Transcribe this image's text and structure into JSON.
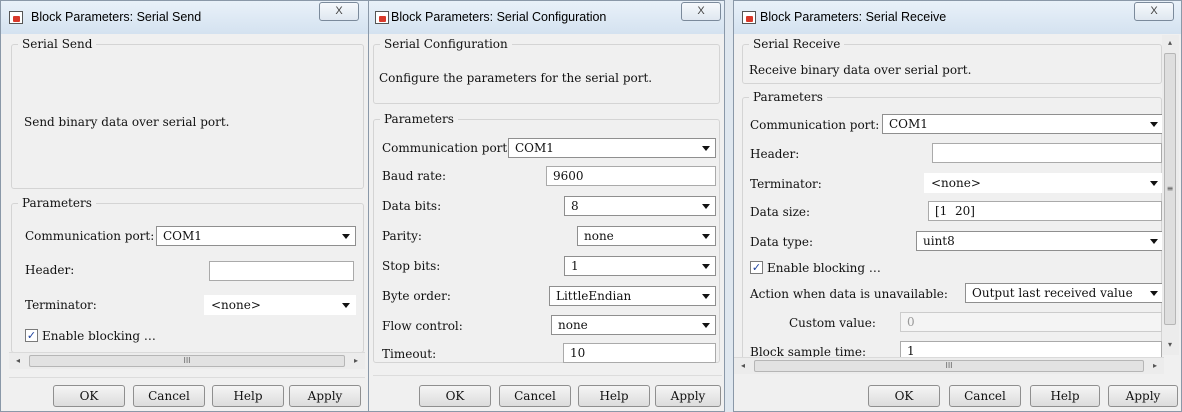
{
  "window_controls": {
    "close_glyph": "X"
  },
  "scroll_glyphs": {
    "left": "◂",
    "right": "▸",
    "up": "▴",
    "down": "▾",
    "thumb": "III",
    "grip": "≡"
  },
  "serial_send": {
    "title": "Block Parameters: Serial Send",
    "group_title": "Serial Send",
    "description": "Send binary data over serial port.",
    "parameters_title": "Parameters",
    "fields": {
      "comm_port": {
        "label": "Communication port:",
        "value": "COM1"
      },
      "header": {
        "label": "Header:",
        "value": ""
      },
      "terminator": {
        "label": "Terminator:",
        "value": "<none>"
      }
    },
    "enable_blocking": {
      "label": "Enable blocking …",
      "checked": true
    },
    "buttons": {
      "ok": "OK",
      "cancel": "Cancel",
      "help": "Help",
      "apply": "Apply"
    }
  },
  "serial_config": {
    "title": "Block Parameters: Serial Configuration",
    "group_title": "Serial Configuration",
    "description": "Configure the parameters for the serial port.",
    "parameters_title": "Parameters",
    "fields": {
      "comm_port": {
        "label": "Communication port:",
        "value": "COM1"
      },
      "baud_rate": {
        "label": "Baud rate:",
        "value": "9600"
      },
      "data_bits": {
        "label": "Data bits:",
        "value": "8"
      },
      "parity": {
        "label": "Parity:",
        "value": "none"
      },
      "stop_bits": {
        "label": "Stop bits:",
        "value": "1"
      },
      "byte_order": {
        "label": "Byte order:",
        "value": "LittleEndian"
      },
      "flow_control": {
        "label": "Flow control:",
        "value": "none"
      },
      "timeout": {
        "label": "Timeout:",
        "value": "10"
      }
    },
    "buttons": {
      "ok": "OK",
      "cancel": "Cancel",
      "help": "Help",
      "apply": "Apply"
    }
  },
  "serial_receive": {
    "title": "Block Parameters: Serial Receive",
    "group_title": "Serial Receive",
    "description": "Receive binary data over serial port.",
    "parameters_title": "Parameters",
    "fields": {
      "comm_port": {
        "label": "Communication port:",
        "value": "COM1"
      },
      "header": {
        "label": "Header:",
        "value": ""
      },
      "terminator": {
        "label": "Terminator:",
        "value": "<none>"
      },
      "data_size": {
        "label": "Data size:",
        "value": "[1  20]"
      },
      "data_type": {
        "label": "Data type:",
        "value": "uint8"
      },
      "action_unavailable": {
        "label": "Action when data is unavailable:",
        "value": "Output last received value"
      },
      "custom_value": {
        "label": "Custom value:",
        "value": "0"
      },
      "block_sample_time": {
        "label": "Block sample time:",
        "value": "1"
      }
    },
    "enable_blocking": {
      "label": "Enable blocking …",
      "checked": true
    },
    "buttons": {
      "ok": "OK",
      "cancel": "Cancel",
      "help": "Help",
      "apply": "Apply"
    }
  }
}
